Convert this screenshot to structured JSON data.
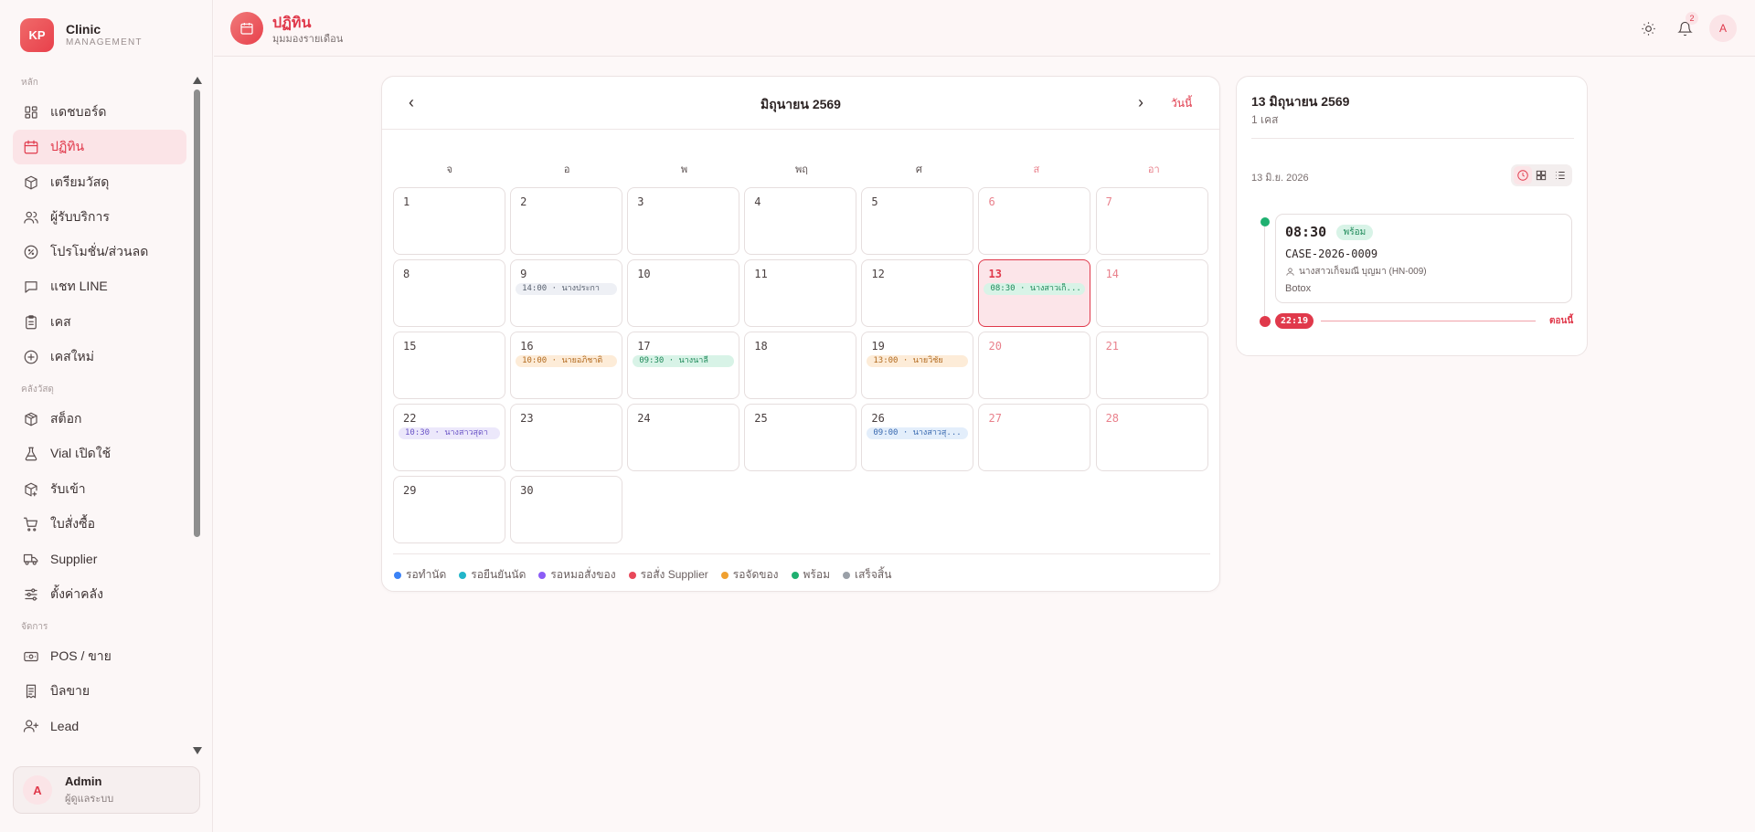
{
  "brand": {
    "logo": "KP",
    "name": "Clinic",
    "sub": "MANAGEMENT"
  },
  "sidebar": {
    "sections": [
      {
        "title": "หลัก",
        "items": [
          {
            "label": "แดชบอร์ด",
            "icon": "dashboard-icon"
          },
          {
            "label": "ปฏิทิน",
            "icon": "calendar-icon",
            "active": true
          },
          {
            "label": "เตรียมวัสดุ",
            "icon": "box-icon"
          },
          {
            "label": "ผู้รับบริการ",
            "icon": "users-icon"
          },
          {
            "label": "โปรโมชั่น/ส่วนลด",
            "icon": "discount-icon"
          },
          {
            "label": "แชท LINE",
            "icon": "chat-icon"
          },
          {
            "label": "เคส",
            "icon": "clipboard-icon"
          },
          {
            "label": "เคสใหม่",
            "icon": "plus-circle-icon"
          }
        ]
      },
      {
        "title": "คลังวัสดุ",
        "items": [
          {
            "label": "สต็อก",
            "icon": "package-icon"
          },
          {
            "label": "Vial เปิดใช้",
            "icon": "flask-icon"
          },
          {
            "label": "รับเข้า",
            "icon": "package-in-icon"
          },
          {
            "label": "ใบสั่งซื้อ",
            "icon": "cart-icon"
          },
          {
            "label": "Supplier",
            "icon": "truck-icon"
          },
          {
            "label": "ตั้งค่าคลัง",
            "icon": "sliders-icon"
          }
        ]
      },
      {
        "title": "จัดการ",
        "items": [
          {
            "label": "POS / ขาย",
            "icon": "cash-icon"
          },
          {
            "label": "บิลขาย",
            "icon": "receipt-icon"
          },
          {
            "label": "Lead",
            "icon": "user-plus-icon"
          }
        ]
      }
    ]
  },
  "user": {
    "initial": "A",
    "name": "Admin",
    "role": "ผู้ดูแลระบบ"
  },
  "header": {
    "title": "ปฏิทิน",
    "subtitle": "มุมมองรายเดือน",
    "notif_count": "2",
    "avatar": "A"
  },
  "calendar": {
    "month_label": "มิถุนายน 2569",
    "today_label": "วันนี้",
    "weekdays": [
      "จ",
      "อ",
      "พ",
      "พฤ",
      "ศ",
      "ส",
      "อา"
    ],
    "days": [
      {
        "n": "1"
      },
      {
        "n": "2"
      },
      {
        "n": "3"
      },
      {
        "n": "4"
      },
      {
        "n": "5"
      },
      {
        "n": "6",
        "w": true
      },
      {
        "n": "7",
        "w": true
      },
      {
        "n": "8"
      },
      {
        "n": "9",
        "e": "14:00 · นางประกา",
        "c": "gray"
      },
      {
        "n": "10"
      },
      {
        "n": "11"
      },
      {
        "n": "12"
      },
      {
        "n": "13",
        "w": true,
        "today": true,
        "e": "08:30 · นางสาวเก็...",
        "c": "green"
      },
      {
        "n": "14",
        "w": true
      },
      {
        "n": "15"
      },
      {
        "n": "16",
        "e": "10:00 · นายอภิชาติ",
        "c": "orange"
      },
      {
        "n": "17",
        "e": "09:30 · นางนาลี",
        "c": "green"
      },
      {
        "n": "18"
      },
      {
        "n": "19",
        "e": "13:00 · นายวิชัย",
        "c": "orange"
      },
      {
        "n": "20",
        "w": true
      },
      {
        "n": "21",
        "w": true
      },
      {
        "n": "22",
        "e": "10:30 · นางสาวสุดา",
        "c": "purple"
      },
      {
        "n": "23"
      },
      {
        "n": "24"
      },
      {
        "n": "25"
      },
      {
        "n": "26",
        "e": "09:00 · นางสาวสุ...",
        "c": "blue"
      },
      {
        "n": "27",
        "w": true
      },
      {
        "n": "28",
        "w": true
      },
      {
        "n": "29"
      },
      {
        "n": "30"
      }
    ],
    "legend": [
      {
        "label": "รอทำนัด",
        "color": "#3b82f6"
      },
      {
        "label": "รอยืนยันนัด",
        "color": "#22b5c9"
      },
      {
        "label": "รอหมอสั่งของ",
        "color": "#8b5cf6"
      },
      {
        "label": "รอสั่ง Supplier",
        "color": "#e8485a"
      },
      {
        "label": "รอจัดของ",
        "color": "#f0a030"
      },
      {
        "label": "พร้อม",
        "color": "#1fb070"
      },
      {
        "label": "เสร็จสิ้น",
        "color": "#9aa0a8"
      }
    ]
  },
  "detail": {
    "date": "13 มิถุนายน 2569",
    "count": "1 เคส",
    "sub_date": "13 มิ.ย. 2026",
    "appointment": {
      "time": "08:30",
      "status": "พร้อม",
      "case_id": "CASE-2026-0009",
      "patient": "นางสาวเก็จมณี บุญมา (HN-009)",
      "service": "Botox"
    },
    "now_time": "22:19",
    "now_label": "ตอนนี้"
  }
}
